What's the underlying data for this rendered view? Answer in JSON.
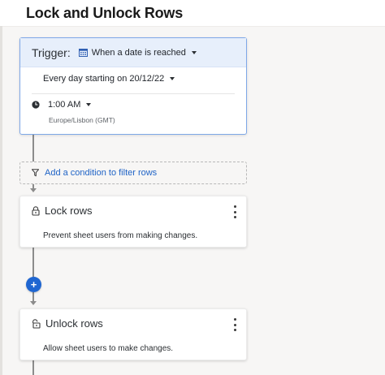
{
  "page": {
    "title": "Lock and Unlock Rows"
  },
  "trigger": {
    "label": "Trigger:",
    "type_value": "When a date is reached",
    "type_icon": "calendar-icon",
    "schedule": "Every day starting on 20/12/22",
    "time": "1:00 AM",
    "time_icon": "clock-icon",
    "timezone": "Europe/Lisbon (GMT)"
  },
  "condition": {
    "label": "Add a condition to filter rows",
    "icon": "filter-icon"
  },
  "actions": [
    {
      "title": "Lock rows",
      "icon": "lock-icon",
      "description": "Prevent sheet users from making changes."
    },
    {
      "title": "Unlock rows",
      "icon": "unlock-icon",
      "description": "Allow sheet users to make changes."
    }
  ],
  "add_step": {
    "label": "+"
  },
  "colors": {
    "accent": "#1f66d1",
    "link": "#1f63c6",
    "trigger_header": "#e7effb",
    "trigger_border": "#7fa8e8",
    "canvas": "#f7f6f5"
  }
}
